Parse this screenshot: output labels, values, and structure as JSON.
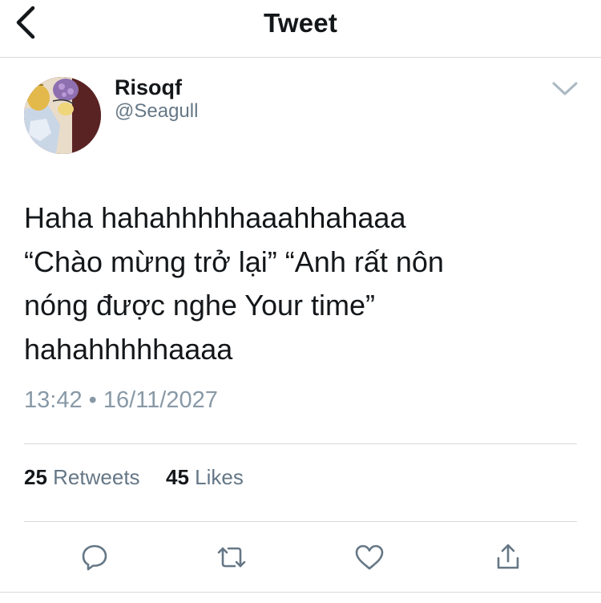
{
  "header": {
    "title": "Tweet"
  },
  "author": {
    "display_name": "Risoqf",
    "handle": "@Seagull"
  },
  "tweet": {
    "lines": [
      "Haha hahahhhhhaaahhahaaa",
      "“Chào mừng trở lại” “Anh rất nôn",
      "nóng được nghe Your time”",
      "hahahhhhhaaaa"
    ],
    "time": "13:42",
    "separator": "•",
    "date": "16/11/2027"
  },
  "stats": {
    "retweets_count": "25",
    "retweets_label": "Retweets",
    "likes_count": "45",
    "likes_label": "Likes"
  },
  "colors": {
    "text": "#14171a",
    "secondary": "#657786",
    "meta": "#8899a6",
    "divider": "#d9d9d9"
  },
  "icons": {
    "back": "chevron-left-icon",
    "caret": "chevron-down-icon",
    "reply": "reply-icon",
    "retweet": "retweet-icon",
    "like": "heart-icon",
    "share": "share-icon"
  }
}
